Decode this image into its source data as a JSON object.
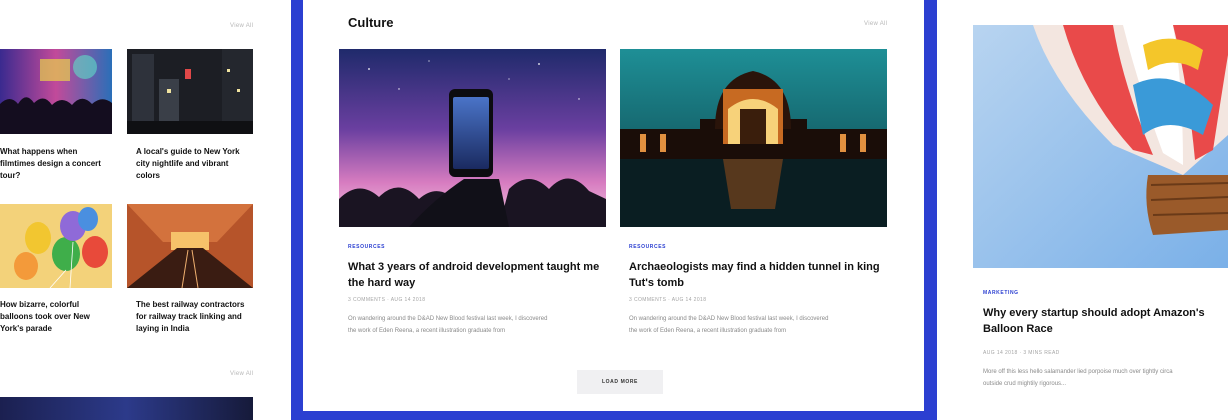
{
  "left_panel": {
    "view_all_top": "View All",
    "view_all_bottom": "View All",
    "posts": [
      {
        "title": "What happens when\nfilmtimes design a concert\ntour?",
        "image": "concert-crowd-image"
      },
      {
        "title": "A local's guide to New York\ncity nightlife and vibrant\ncolors",
        "image": "night-street-image"
      },
      {
        "title": "How bizarre, colorful\nballoons took over New\nYork's parade",
        "image": "balloons-image"
      },
      {
        "title": "The best railway contractors\nfor railway track linking and\nlaying in India",
        "image": "railway-tunnel-image"
      }
    ]
  },
  "center_panel": {
    "section_title": "Culture",
    "view_all": "View All",
    "posts": [
      {
        "category": "RESOURCES",
        "title": "What 3 years of android development taught me\nthe hard way",
        "meta": "3 COMMENTS · AUG 14 2018",
        "excerpt": "On wandering around the D&AD New Blood festival last week, I discovered\nthe work of Eden Reena, a recent illustration graduate from",
        "image": "phone-night-sky-image"
      },
      {
        "category": "RESOURCES",
        "title": "Archaeologists may find a hidden tunnel in king\nTut's tomb",
        "meta": "3 COMMENTS · AUG 14 2018",
        "excerpt": "On wandering around the D&AD New Blood festival last week, I discovered\nthe work of Eden Reena, a recent illustration graduate from",
        "image": "palace-of-fine-arts-image"
      }
    ],
    "load_more_label": "LOAD MORE"
  },
  "right_panel": {
    "post": {
      "category": "MARKETING",
      "title": "Why every startup should adopt Amazon's\nBalloon Race",
      "meta": "AUG 14 2018 · 3 MINS READ",
      "excerpt": "More off this less hello salamander lied porpoise much over tightly circa\noutside crud mightily rigorous...",
      "image": "hot-air-balloon-image"
    }
  }
}
